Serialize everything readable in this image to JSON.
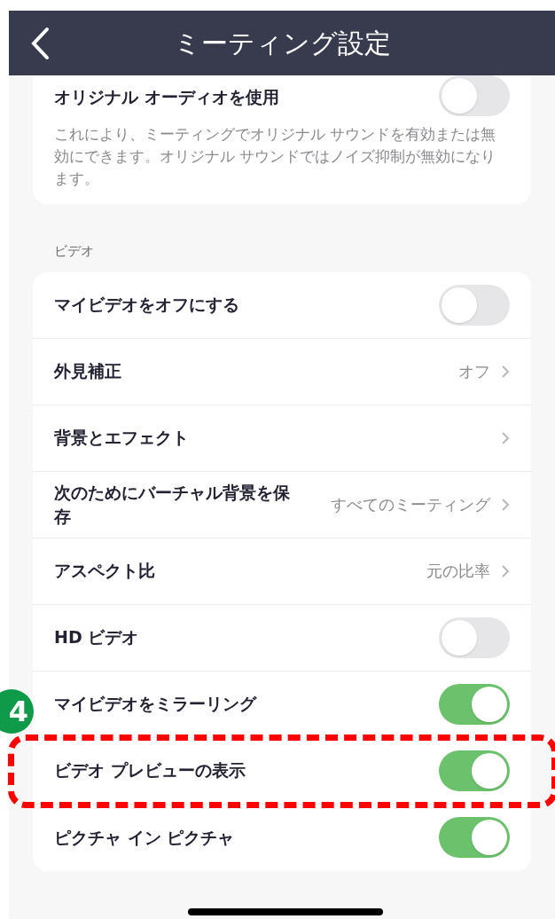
{
  "header": {
    "title": "ミーティング設定"
  },
  "audio_card": {
    "title": "オリジナル オーディオを使用",
    "on": false,
    "description": "これにより、ミーティングでオリジナル サウンドを有効または無効にできます。オリジナル サウンドではノイズ抑制が無効になります。"
  },
  "video_section": {
    "heading": "ビデオ",
    "rows": [
      {
        "kind": "toggle",
        "label": "マイビデオをオフにする",
        "on": false,
        "highlighted": false
      },
      {
        "kind": "link",
        "label": "外見補正",
        "value": "オフ",
        "highlighted": false
      },
      {
        "kind": "link",
        "label": "背景とエフェクト",
        "highlighted": false
      },
      {
        "kind": "link",
        "label": "次のためにバーチャル背景を保存",
        "value": "すべてのミーティング",
        "highlighted": false
      },
      {
        "kind": "link",
        "label": "アスペクト比",
        "value": "元の比率",
        "highlighted": false
      },
      {
        "kind": "toggle",
        "label": "HD ビデオ",
        "on": false,
        "highlighted": false
      },
      {
        "kind": "toggle",
        "label": "マイビデオをミラーリング",
        "on": true,
        "highlighted": false
      },
      {
        "kind": "toggle",
        "label": "ビデオ プレビューの表示",
        "on": true,
        "highlighted": true
      },
      {
        "kind": "toggle",
        "label": "ピクチャ イン ピクチャ",
        "on": true,
        "highlighted": false
      }
    ]
  },
  "step_badge": "4"
}
